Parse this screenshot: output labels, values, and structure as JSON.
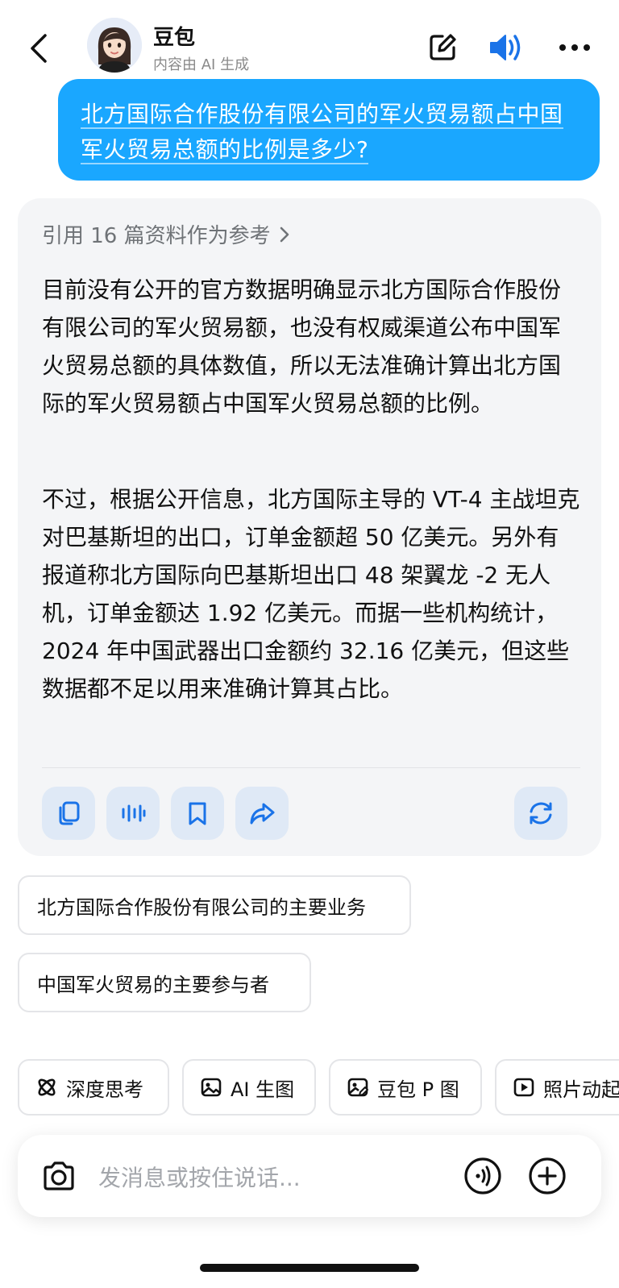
{
  "header": {
    "title": "豆包",
    "subtitle": "内容由 AI 生成",
    "icons": [
      "back-icon",
      "edit-icon",
      "speaker-icon",
      "more-icon"
    ],
    "accent_color": "#1a73e8"
  },
  "user_message": {
    "text": "北方国际合作股份有限公司的军火贸易额占中国军火贸易总额的比例是多少?",
    "bubble_color": "#1aa7ff"
  },
  "answer": {
    "references_label": "引用 16 篇资料作为参考",
    "paragraph_1": "目前没有公开的官方数据明确显示北方国际合作股份有限公司的军火贸易额，也没有权威渠道公布中国军火贸易总额的具体数值，所以无法准确计算出北方国际的军火贸易额占中国军火贸易总额的比例。",
    "paragraph_2": "不过，根据公开信息，北方国际主导的 VT-4 主战坦克对巴基斯坦的出口，订单金额超 50 亿美元。另外有报道称北方国际向巴基斯坦出口 48 架翼龙 -2 无人机，订单金额达 1.92 亿美元。而据一些机构统计，2024 年中国武器出口金额约 32.16 亿美元，但这些数据都不足以用来准确计算其占比。",
    "actions": [
      "copy-icon",
      "voice-wave-icon",
      "bookmark-icon",
      "share-icon",
      "regenerate-icon"
    ]
  },
  "suggestions": [
    "北方国际合作股份有限公司的主要业务",
    "中国军火贸易的主要参与者"
  ],
  "tools": [
    {
      "label": "深度思考",
      "icon": "atom-icon"
    },
    {
      "label": "AI 生图",
      "icon": "image-icon"
    },
    {
      "label": "豆包 P 图",
      "icon": "image-edit-icon"
    },
    {
      "label": "照片动起",
      "icon": "play-icon"
    }
  ],
  "input": {
    "placeholder": "发消息或按住说话..."
  }
}
